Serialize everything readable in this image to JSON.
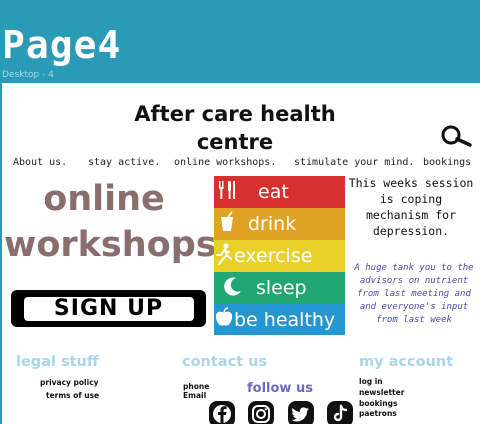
{
  "artboard": {
    "title": "Page4",
    "frame_label": "Desktop - 4"
  },
  "header": {
    "site_title": "After care health centre",
    "search_icon": "search-icon"
  },
  "nav": {
    "items": [
      {
        "label": "About us."
      },
      {
        "label": "stay active."
      },
      {
        "label": "online workshops."
      },
      {
        "label": "stimulate your mind."
      },
      {
        "label": "bookings"
      }
    ]
  },
  "hero": {
    "heading_line1": "online",
    "heading_line2": "workshops",
    "signup_label": "SIGN UP"
  },
  "poster": {
    "items": [
      {
        "icon": "cutlery-icon",
        "label": "eat",
        "color": "#d6312f"
      },
      {
        "icon": "glass-icon",
        "label": "drink",
        "color": "#e1a326"
      },
      {
        "icon": "running-person-icon",
        "label": "exercise",
        "color": "#e9d12a"
      },
      {
        "icon": "moon-icon",
        "label": "sleep",
        "color": "#21a773"
      },
      {
        "icon": "apple-icon",
        "label": "be healthy",
        "color": "#2596cf"
      }
    ]
  },
  "session": {
    "text": "This weeks session is coping mechanism for depression.",
    "thanks": "A huge tank you to the advisors on nutrient from last meeting and and everyone's input from last week"
  },
  "footer": {
    "legal": {
      "heading": "legal stuff",
      "links": [
        "privacy policy",
        "terms of use"
      ]
    },
    "contact": {
      "heading": "contact us",
      "lines": [
        "phone",
        "Email"
      ]
    },
    "account": {
      "heading": "my account",
      "links": [
        "log in",
        "newsletter",
        "bookings",
        "paetrons"
      ]
    },
    "follow": {
      "heading": "follow us",
      "icons": [
        "facebook-icon",
        "instagram-icon",
        "twitter-icon",
        "tiktok-icon"
      ]
    }
  },
  "colors": {
    "top_bar": "#2a9bb6",
    "hero_heading": "#8a6d6d",
    "footer_heading": "#a9d6ea",
    "follow_heading": "#6b6bbf",
    "thanks_text": "#4a4aa6"
  }
}
